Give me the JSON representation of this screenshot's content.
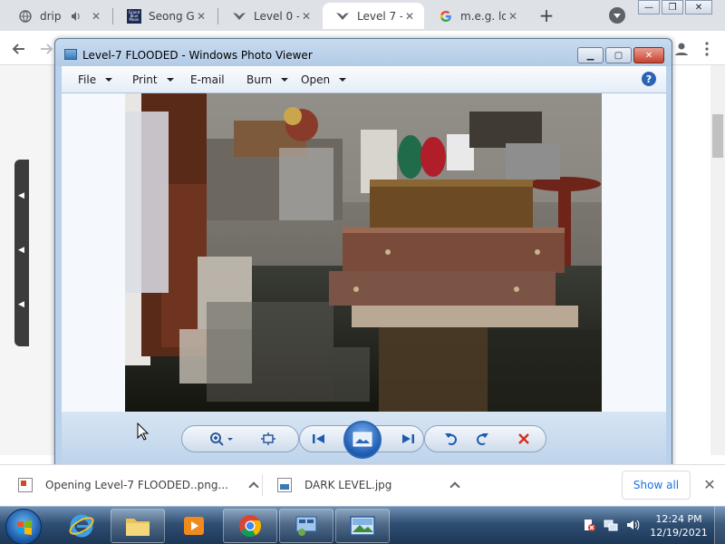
{
  "browser": {
    "tabs": [
      {
        "label": "drip",
        "active": false
      },
      {
        "label": "Seong Gi",
        "active": false
      },
      {
        "label": "Level 0 -",
        "active": false
      },
      {
        "label": "Level 7 -",
        "active": true
      },
      {
        "label": "m.e.g. log",
        "active": false
      }
    ],
    "favicon_text": "Grand Blue Moon"
  },
  "photo_viewer": {
    "title": "Level-7 FLOODED - Windows Photo Viewer",
    "menu": [
      {
        "label": "File",
        "has_dropdown": true
      },
      {
        "label": "Print",
        "has_dropdown": true
      },
      {
        "label": "E-mail",
        "has_dropdown": false
      },
      {
        "label": "Burn",
        "has_dropdown": true
      },
      {
        "label": "Open",
        "has_dropdown": true
      }
    ],
    "help_label": "?"
  },
  "downloads": {
    "items": [
      {
        "label": "Opening Level-7 FLOODED..png..."
      },
      {
        "label": "DARK LEVEL.jpg"
      }
    ],
    "show_all": "Show all"
  },
  "taskbar": {
    "time": "12:24 PM",
    "date": "12/19/2021"
  },
  "colors": {
    "chrome_tabstrip": "#dee1e6",
    "viewer_frame": "#b9d1ea",
    "taskbar": "#2f4e72",
    "accent": "#1a73e8",
    "close_red": "#c6422c"
  }
}
